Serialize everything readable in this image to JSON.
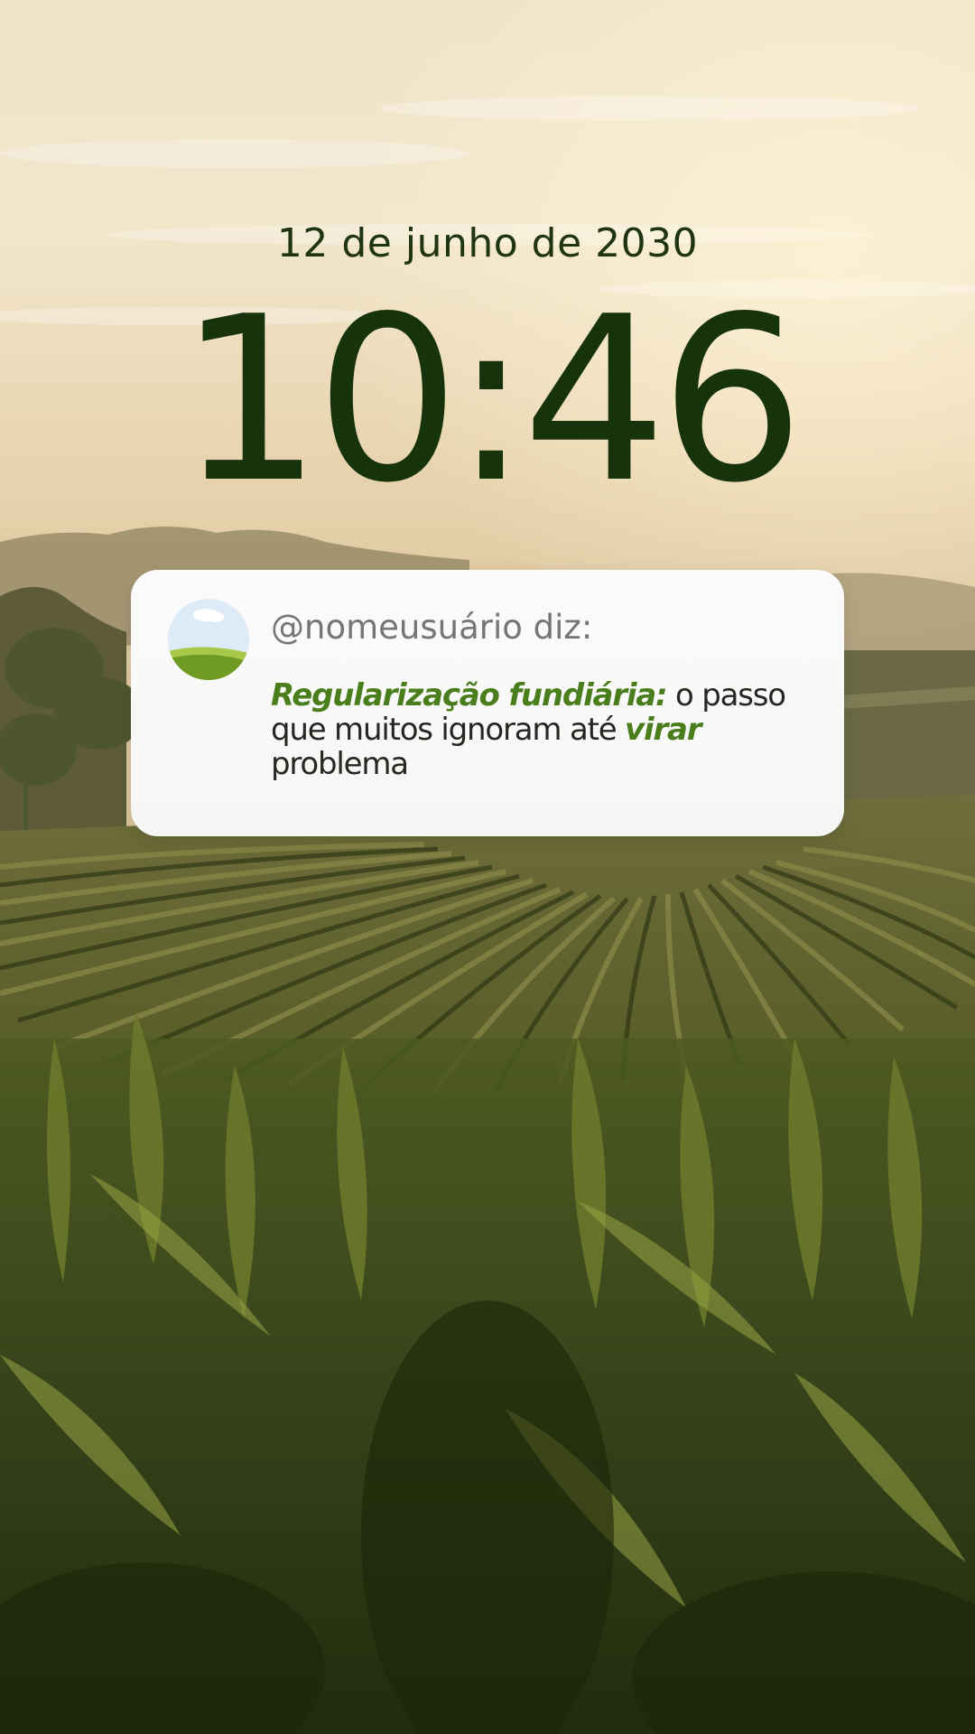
{
  "lock_screen": {
    "date": "12 de junho de 2030",
    "time": "10:46"
  },
  "notification": {
    "sender": "@nomeusuário diz:",
    "message": {
      "part1": "Regularização fundiária:",
      "part2": " o passo que muitos ignoram até ",
      "part3": "virar",
      "part4": " problema"
    },
    "avatar_icon": "landscape-avatar-icon"
  },
  "colors": {
    "clock": "#17330b",
    "date": "#1f3512",
    "highlight": "#4a7d1b",
    "sender": "#757575",
    "message": "#252822",
    "card": "#f8f8f7"
  }
}
